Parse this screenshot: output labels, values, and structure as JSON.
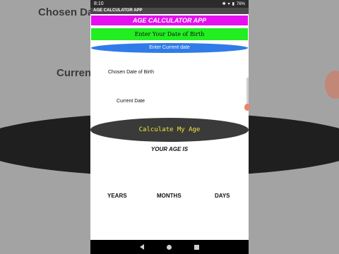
{
  "status_bar": {
    "time": "8:10",
    "battery": "76%"
  },
  "app_bar": {
    "title": "AGE CALCULATOR APP"
  },
  "header": {
    "title": "AGE CALCULATOR APP"
  },
  "buttons": {
    "enter_dob": "Enter Your Date of Birth",
    "enter_current": "Enter Current date",
    "calculate": "Calculate My Age"
  },
  "labels": {
    "chosen_dob": "Chosen Date of Birth",
    "current_date": "Current Date",
    "your_age_is": "YOUR AGE IS",
    "years": "YEARS",
    "months": "MONTHS",
    "days": "DAYS"
  },
  "background": {
    "chosen_text": "Chosen Date",
    "current_text": "Current"
  },
  "colors": {
    "title_bg": "#e60ff0",
    "dob_bg": "#22ee22",
    "current_bg": "#2f7be8",
    "calc_bg": "#3a3a3a",
    "calc_text": "#f5e83a"
  }
}
